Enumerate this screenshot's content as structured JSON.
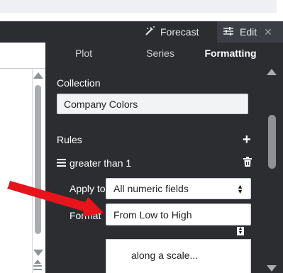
{
  "toolbar": {
    "forecast_label": "Forecast",
    "edit_label": "Edit",
    "close_glyph": "✕"
  },
  "tabs": [
    {
      "label": "Plot"
    },
    {
      "label": "Series"
    },
    {
      "label": "Formatting"
    }
  ],
  "formatting": {
    "collection_label": "Collection",
    "collection_value": "Company Colors",
    "rules_label": "Rules",
    "rule_name": "greater than 1",
    "apply_label": "Apply to",
    "apply_value": "All numeric fields",
    "format_label": "Format",
    "format_value": "From Low to High",
    "dropdown_option": "along a scale..."
  },
  "annotation": {
    "arrow_color": "#e8141c"
  },
  "icons": {
    "forecast": "forecast-wand-icon",
    "edit": "sliders-icon",
    "add": "plus-icon",
    "delete": "trash-icon",
    "menu": "hamburger-icon"
  }
}
